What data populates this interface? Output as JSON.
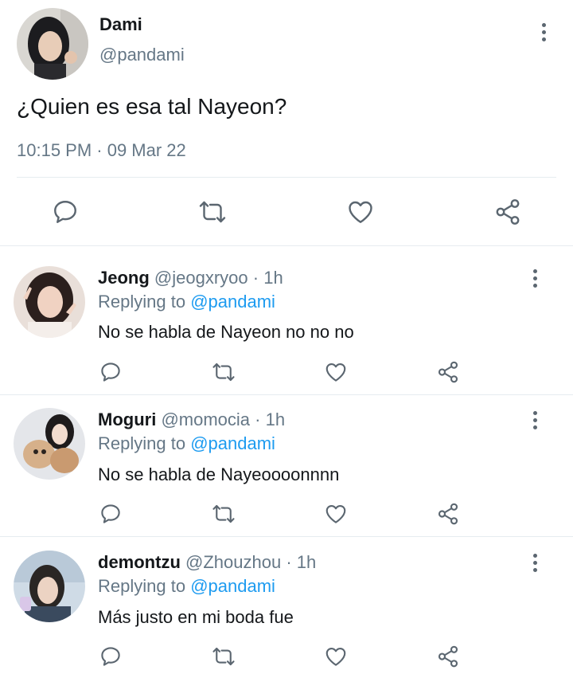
{
  "main_tweet": {
    "author_name": "Dami",
    "author_handle": "@pandami",
    "text": "¿Quien es esa tal Nayeon?",
    "timestamp": "10:15 PM · 09 Mar 22"
  },
  "replies": [
    {
      "author_name": "Jeong",
      "author_handle": "@jeogxryoo",
      "time": "· 1h",
      "replying_label": "Replying to",
      "replying_to": "@pandami",
      "text": "No se habla de Nayeon no no no"
    },
    {
      "author_name": "Moguri",
      "author_handle": "@momocia",
      "time": "· 1h",
      "replying_label": "Replying to",
      "replying_to": "@pandami",
      "text": "No se habla de Nayeoooonnnn"
    },
    {
      "author_name": "demontzu",
      "author_handle": "@Zhouzhou",
      "time": "· 1h",
      "replying_label": "Replying to",
      "replying_to": "@pandami",
      "text": "Más justo en mi boda fue"
    }
  ],
  "icons": {
    "reply": "speech-bubble",
    "retweet": "retweet-arrows",
    "like": "heart-outline",
    "share": "share-nodes",
    "more": "vertical-ellipsis"
  },
  "colors": {
    "text": "#14171a",
    "muted": "#657786",
    "link": "#1d9bf0",
    "icon": "#5b6670",
    "divider": "#e6ecf0"
  }
}
